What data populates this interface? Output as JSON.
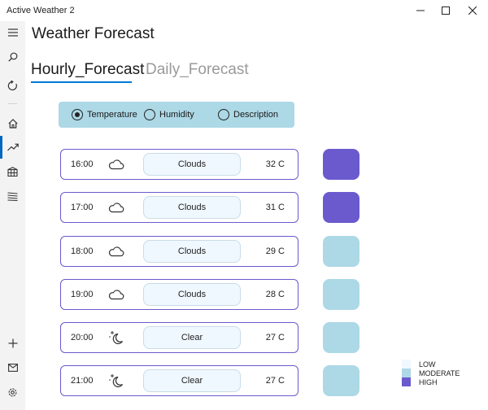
{
  "window": {
    "title": "Active Weather 2"
  },
  "page": {
    "title": "Weather Forecast",
    "tabs": [
      {
        "label": "Hourly_Forecast",
        "selected": true
      },
      {
        "label": "Daily_Forecast",
        "selected": false
      }
    ]
  },
  "sidebar": {
    "items": [
      {
        "name": "hamburger-menu-icon"
      },
      {
        "name": "search-icon"
      },
      {
        "name": "refresh-icon"
      },
      {
        "name": "home-icon"
      },
      {
        "name": "trend-icon",
        "active": true
      },
      {
        "name": "grid-city-icon"
      },
      {
        "name": "wind-lines-icon"
      },
      {
        "name": "add-icon"
      },
      {
        "name": "mail-icon"
      },
      {
        "name": "settings-icon"
      }
    ]
  },
  "view_options": {
    "selected": "Temperature",
    "options": [
      "Temperature",
      "Humidity",
      "Description"
    ]
  },
  "forecast": [
    {
      "time": "16:00",
      "icon": "cloud-icon",
      "description": "Clouds",
      "temperature": "32 C",
      "level": "HIGH"
    },
    {
      "time": "17:00",
      "icon": "cloud-icon",
      "description": "Clouds",
      "temperature": "31 C",
      "level": "HIGH"
    },
    {
      "time": "18:00",
      "icon": "cloud-icon",
      "description": "Clouds",
      "temperature": "29 C",
      "level": "MODERATE"
    },
    {
      "time": "19:00",
      "icon": "cloud-icon",
      "description": "Clouds",
      "temperature": "28 C",
      "level": "MODERATE"
    },
    {
      "time": "20:00",
      "icon": "moon-clear-icon",
      "description": "Clear",
      "temperature": "27 C",
      "level": "MODERATE"
    },
    {
      "time": "21:00",
      "icon": "moon-clear-icon",
      "description": "Clear",
      "temperature": "27 C",
      "level": "MODERATE"
    }
  ],
  "legend": [
    {
      "label": "LOW",
      "color": "#f0f8ff"
    },
    {
      "label": "MODERATE",
      "color": "#add8e6"
    },
    {
      "label": "HIGH",
      "color": "#6a5acd"
    }
  ],
  "colors": {
    "accent": "#0078d4",
    "panel": "#add8e6",
    "row_border": "#6a5acd",
    "high": "#6a5acd",
    "moderate": "#add8e6",
    "low": "#f0f8ff"
  }
}
